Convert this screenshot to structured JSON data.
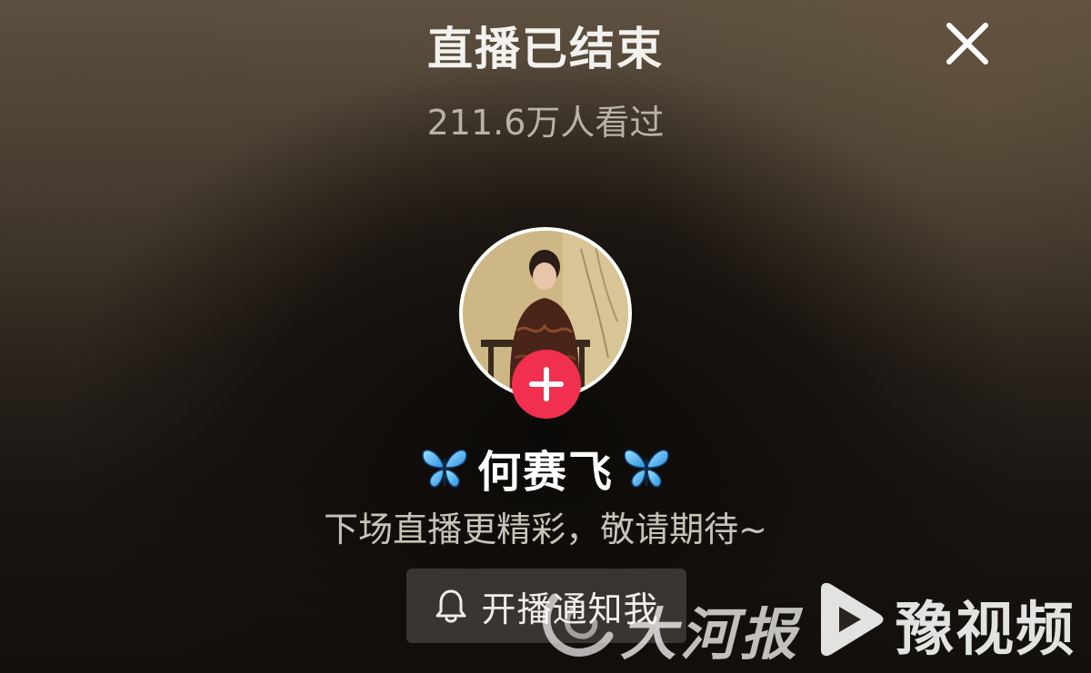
{
  "header": {
    "title": "直播已结束",
    "viewers": "211.6万人看过"
  },
  "streamer": {
    "name": "何赛飞",
    "name_emoji": "🦋",
    "tagline": "下场直播更精彩，敬请期待~"
  },
  "actions": {
    "notify_label": "开播通知我"
  },
  "watermarks": {
    "dahe": "大河报",
    "yu": "豫视频"
  },
  "colors": {
    "follow_button": "#f0304e",
    "notify_background": "#5a5650",
    "text_primary": "#ffffff",
    "text_secondary": "#b9b2a6"
  },
  "icons": {
    "close": "close-icon",
    "follow": "plus-icon",
    "notify": "bell-icon",
    "name_decoration": "butterfly-icon"
  }
}
